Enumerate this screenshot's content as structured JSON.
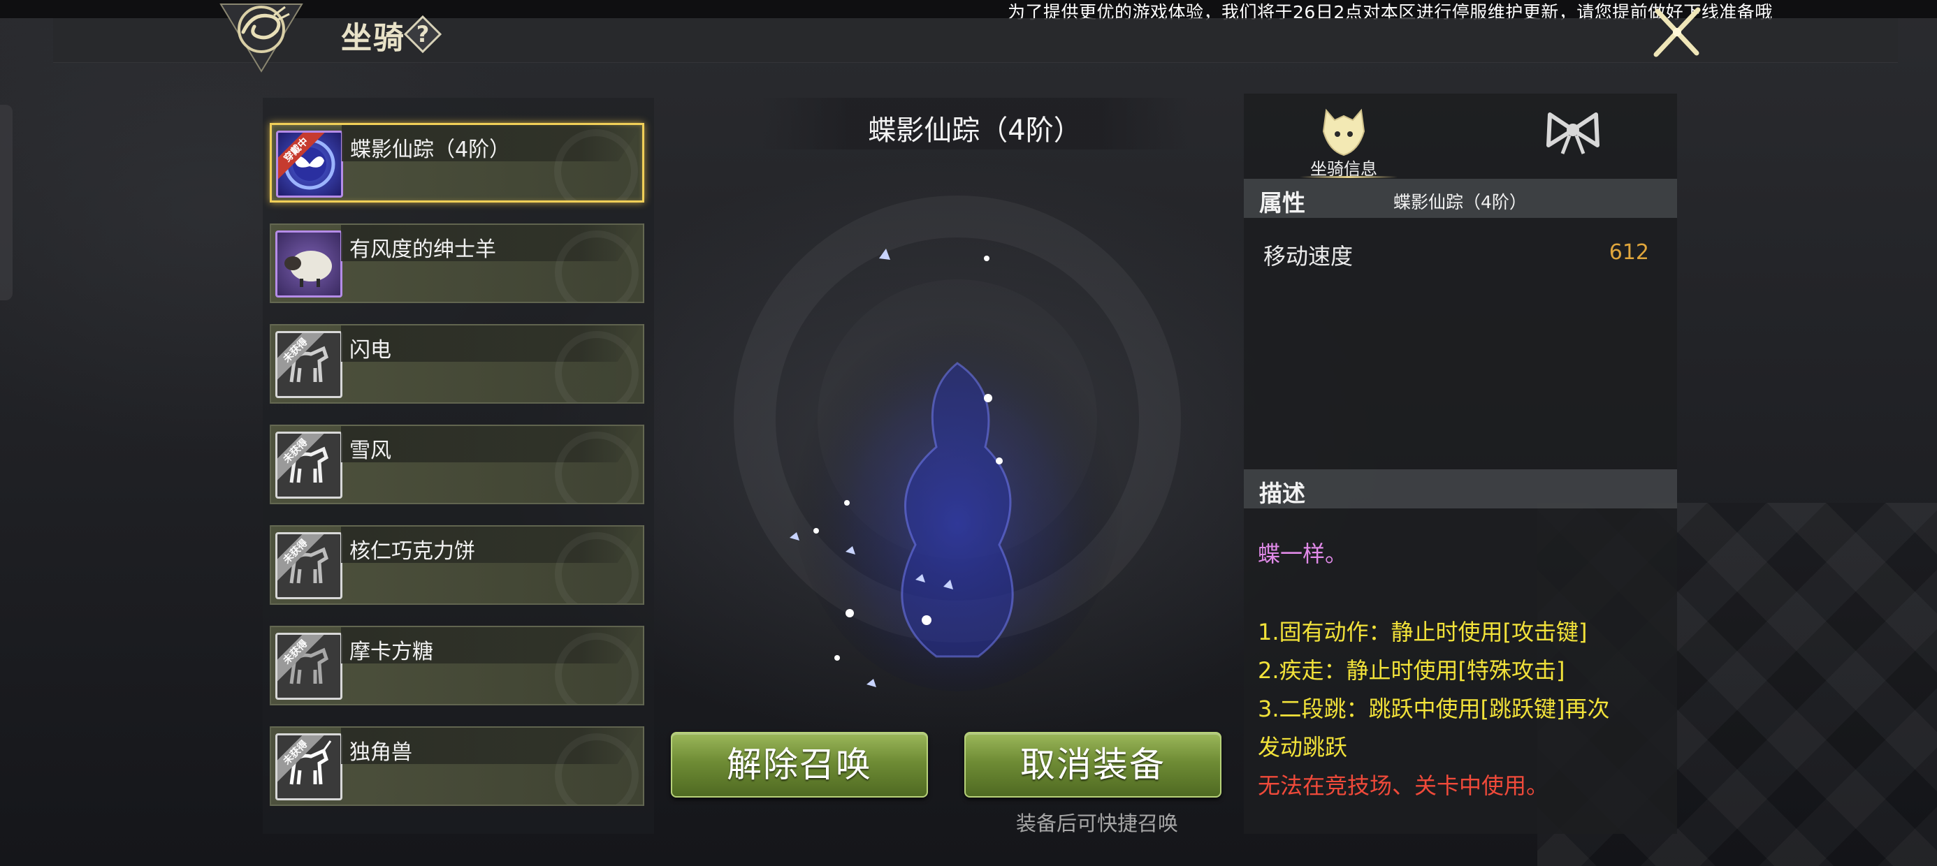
{
  "notice": "为了提供更优的游戏体验，我们将于26日2点对本区进行停服维护更新，请您提前做好下线准备哦",
  "header": {
    "title": "坐骑",
    "help_icon": "question-mark-icon",
    "close_icon": "close-x-icon"
  },
  "mount_list": [
    {
      "name": "蝶影仙踪（4阶）",
      "status": "穿戴中",
      "selected": true,
      "icon": "butterfly-mount-icon"
    },
    {
      "name": "有风度的绅士羊",
      "status": "",
      "selected": false,
      "icon": "sheep-mount-icon"
    },
    {
      "name": "闪电",
      "status": "未获得",
      "selected": false,
      "icon": "horse-mount-icon"
    },
    {
      "name": "雪风",
      "status": "未获得",
      "selected": false,
      "icon": "horse-mount-icon"
    },
    {
      "name": "核仁巧克力饼",
      "status": "未获得",
      "selected": false,
      "icon": "horse-mount-icon"
    },
    {
      "name": "摩卡方糖",
      "status": "未获得",
      "selected": false,
      "icon": "horse-mount-icon"
    },
    {
      "name": "独角兽",
      "status": "未获得",
      "selected": false,
      "icon": "unicorn-mount-icon"
    }
  ],
  "preview": {
    "title": "蝶影仙踪（4阶）",
    "dismiss_button": "解除召唤",
    "unequip_button": "取消装备",
    "hint": "装备后可快捷召唤"
  },
  "info": {
    "tabs": [
      {
        "label": "坐骑信息",
        "icon": "mount-info-icon",
        "active": true
      },
      {
        "label": "",
        "icon": "bow-icon",
        "active": false
      }
    ],
    "attributes": {
      "heading": "属性",
      "mount_name": "蝶影仙踪（4阶）",
      "stats": [
        {
          "label": "移动速度",
          "value": "612"
        }
      ]
    },
    "description": {
      "heading": "描述",
      "lines": [
        {
          "text": "蝶一样。",
          "color": "#e08ae8"
        },
        {
          "text": "1.固有动作：静止时使用[攻击键]",
          "color": "#f2e23a"
        },
        {
          "text": "2.疾走：静止时使用[特殊攻击]",
          "color": "#f2e23a"
        },
        {
          "text": "3.二段跳：跳跃中使用[跳跃键]再次",
          "color": "#f2e23a"
        },
        {
          "text": "发动跳跃",
          "color": "#f2e23a"
        },
        {
          "text": "无法在竞技场、关卡中使用。",
          "color": "#f04a3a"
        }
      ]
    }
  }
}
